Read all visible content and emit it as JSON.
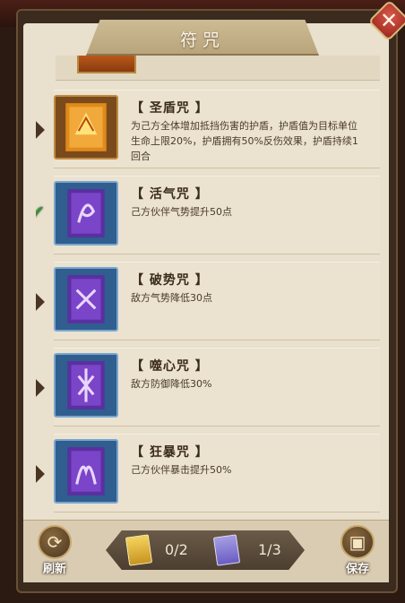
{
  "title": "符咒",
  "close_icon": "close-icon",
  "spells": [
    {
      "name": "【 圣盾咒 】",
      "desc": "为己方全体增加抵挡伤害的护盾，护盾值为目标单位生命上限20%，护盾拥有50%反伤效果，护盾持续1回合",
      "type": "gold",
      "selected": false
    },
    {
      "name": "【 活气咒 】",
      "desc": "己方伙伴气势提升50点",
      "type": "blue",
      "selected": true
    },
    {
      "name": "【 破势咒 】",
      "desc": "敌方气势降低30点",
      "type": "blue",
      "selected": false
    },
    {
      "name": "【 噬心咒 】",
      "desc": "敌方防御降低30%",
      "type": "blue",
      "selected": false
    },
    {
      "name": "【 狂暴咒 】",
      "desc": "己方伙伴暴击提升50%",
      "type": "blue",
      "selected": false
    }
  ],
  "footer": {
    "refresh_label": "刷新",
    "save_label": "保存",
    "gold_count": "0/2",
    "blue_count": "1/3"
  },
  "colors": {
    "accent_gold": "#c9941f",
    "accent_blue": "#6a5cc4",
    "check": "#3c8f3a"
  }
}
